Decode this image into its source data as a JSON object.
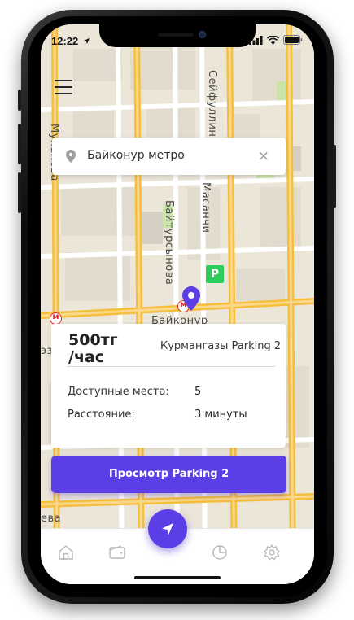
{
  "status_bar": {
    "time": "12:22"
  },
  "map": {
    "streets": {
      "seifullina": "Сейфуллина",
      "mukanova": "Муканова",
      "masanchi": "Масанчи",
      "baitursynova": "Байтурсынова",
      "baikonur": "Байконур",
      "left_edge": "эз",
      "bottom_left": "ева"
    },
    "parking_marker": "P",
    "metro_icon": "м"
  },
  "search": {
    "value": "Байконур метро"
  },
  "parking_card": {
    "price": "500тг /час",
    "name": "Курмангазы Parking 2",
    "available_label": "Доступные места:",
    "available_value": "5",
    "distance_label": "Расстояние:",
    "distance_value": "3 минуты"
  },
  "cta": {
    "label": "Просмотр Parking 2"
  },
  "tabbar": {
    "tabs": [
      "home-icon",
      "wallet-icon",
      "navigation-icon",
      "pie-chart-icon",
      "settings-icon"
    ]
  },
  "colors": {
    "accent": "#5b3ee6",
    "road": "#f6be3d",
    "parking": "#2ecc5a",
    "metro": "#e02a2a"
  }
}
